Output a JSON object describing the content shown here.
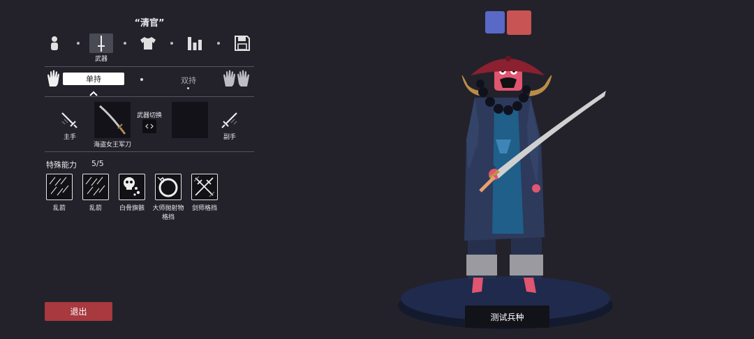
{
  "unit_name": "“清官”",
  "tabs": {
    "active_label": "武器",
    "items": [
      {
        "icon": "person-icon"
      },
      {
        "icon": "sword-icon"
      },
      {
        "icon": "shirt-icon"
      },
      {
        "icon": "stats-icon"
      },
      {
        "icon": "save-icon"
      }
    ]
  },
  "hand_mode": {
    "single": "单持",
    "dual": "双持"
  },
  "weapons": {
    "main_hand_label": "主手",
    "off_hand_label": "副手",
    "switch_label": "武器切换",
    "main_weapon_name": "海盗女王军刀"
  },
  "skills": {
    "title": "特殊能力",
    "count": "5/5",
    "items": [
      {
        "label": "乱箭",
        "icon": "arrow-rain-icon"
      },
      {
        "label": "乱箭",
        "icon": "arrow-rain-icon"
      },
      {
        "label": "白骨旗骸",
        "icon": "skull-icon"
      },
      {
        "label": "大师抛射物\n格挡",
        "icon": "projectile-block-icon"
      },
      {
        "label": "剑师格挡",
        "icon": "sword-block-icon"
      }
    ]
  },
  "exit_label": "退出",
  "test_unit_label": "测试兵种",
  "colors": {
    "team_blue": "#5a68c8",
    "team_red": "#c85454",
    "exit_button": "#a7393f",
    "background": "#23222b"
  }
}
